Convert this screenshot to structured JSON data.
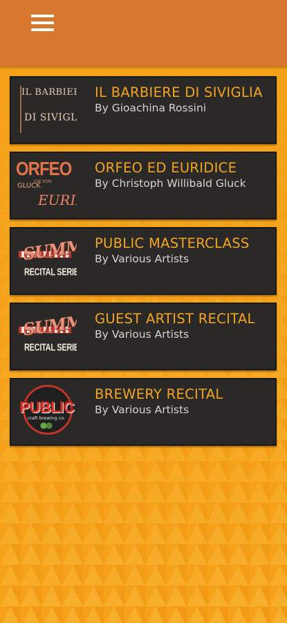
{
  "header": {
    "menu_icon": "hamburger-menu-icon",
    "bar_color": "#d8772e"
  },
  "colors": {
    "background": "#f5a21a",
    "card_background": "#2a2928",
    "title_color": "#f3a521",
    "subtitle_color": "#d4d4d4"
  },
  "events": [
    {
      "title": "IL BARBIERE DI SIVIGLIA",
      "subtitle": "By Gioachina Rossini",
      "thumb": {
        "line1": "IL BARBIERE",
        "line2": "DI SIVIGLIA"
      }
    },
    {
      "title": "ORFEO ED EURIDICE",
      "subtitle": "By Christoph Willibald Gluck",
      "thumb": {
        "line1": "ORFEO",
        "line2": "CW VON",
        "line3": "GLUCK",
        "line4": "EURIDICE"
      }
    },
    {
      "title": "PUBLIC MASTERCLASS",
      "subtitle": "By Various Artists",
      "thumb": {
        "line1": "SUMMER",
        "line2": "RECITAL SERIES"
      }
    },
    {
      "title": "GUEST ARTIST RECITAL",
      "subtitle": "By Various Artists",
      "thumb": {
        "line1": "SUMMER",
        "line2": "RECITAL SERIES"
      }
    },
    {
      "title": "BREWERY RECITAL",
      "subtitle": "By Various Artists",
      "thumb": {
        "line1": "PUBLIC",
        "line2": "craft brewing co."
      }
    }
  ]
}
